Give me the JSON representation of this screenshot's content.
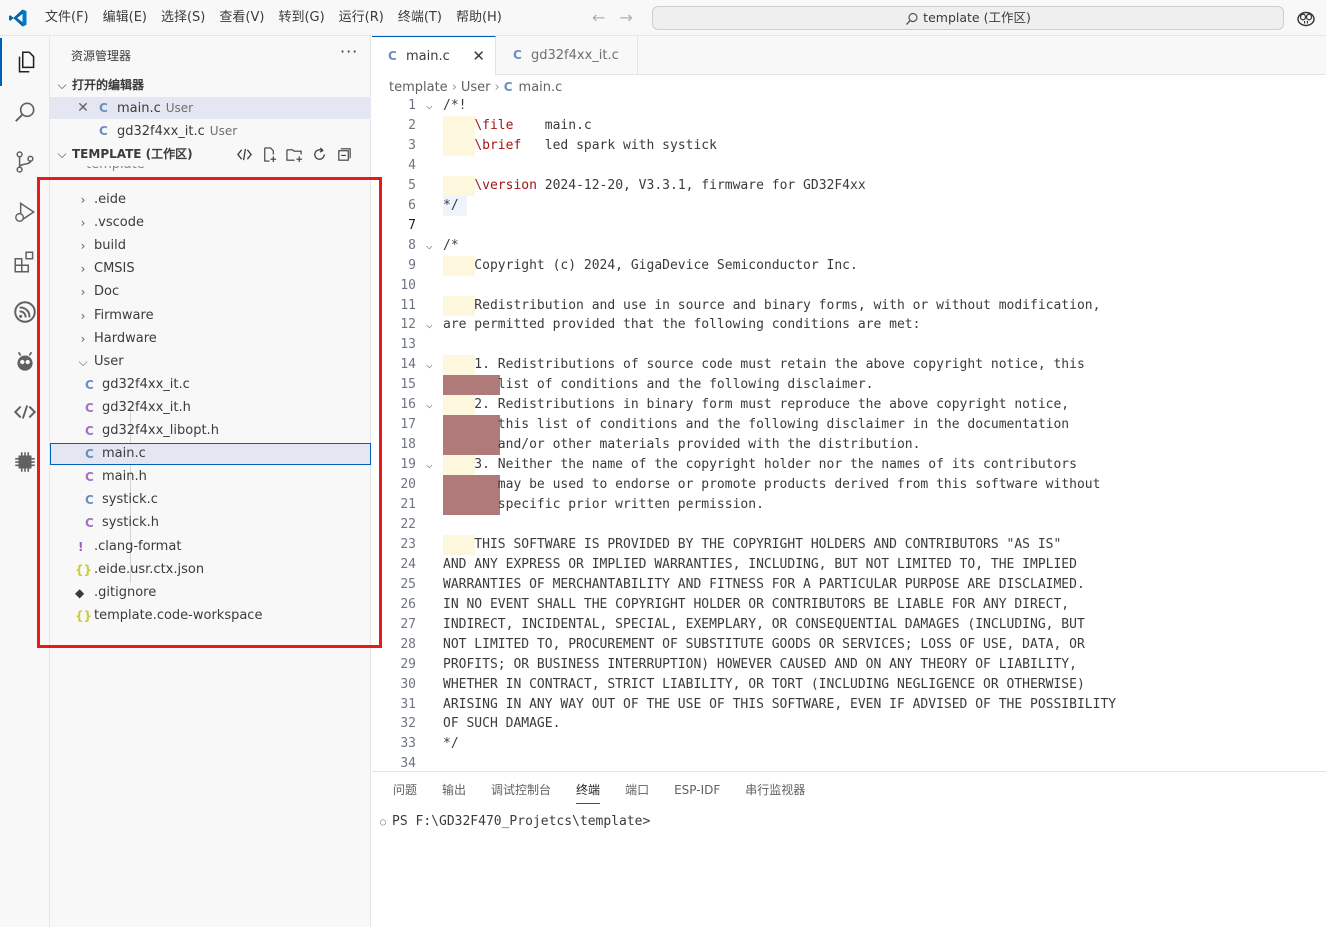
{
  "menu": [
    "文件(F)",
    "编辑(E)",
    "选择(S)",
    "查看(V)",
    "转到(G)",
    "运行(R)",
    "终端(T)",
    "帮助(H)"
  ],
  "command_center": "template (工作区)",
  "sidebar": {
    "title": "资源管理器",
    "more": "···",
    "open_editors": {
      "label": "打开的编辑器",
      "items": [
        {
          "name": "main.c",
          "desc": "User"
        },
        {
          "name": "gd32f4xx_it.c",
          "desc": "User"
        }
      ]
    },
    "workspace": {
      "label": "TEMPLATE (工作区)",
      "root": "template",
      "folders": [
        ".eide",
        ".vscode",
        "build",
        "CMSIS",
        "Doc",
        "Firmware",
        "Hardware",
        "User"
      ],
      "user_files": [
        "gd32f4xx_it.c",
        "gd32f4xx_it.h",
        "gd32f4xx_libopt.h",
        "main.c",
        "main.h",
        "systick.c",
        "systick.h"
      ],
      "root_files": [
        ".clang-format",
        ".eide.usr.ctx.json",
        ".gitignore",
        "template.code-workspace"
      ]
    }
  },
  "tabs": [
    {
      "label": "main.c",
      "active": true
    },
    {
      "label": "gd32f4xx_it.c",
      "active": false
    }
  ],
  "breadcrumb": [
    "template",
    "User",
    "main.c"
  ],
  "code_lines": [
    "/*!",
    "    \\file    main.c",
    "    \\brief   led spark with systick",
    "",
    "    \\version 2024-12-20, V3.3.1, firmware for GD32F4xx",
    "*/",
    "",
    "/*",
    "    Copyright (c) 2024, GigaDevice Semiconductor Inc.",
    "",
    "    Redistribution and use in source and binary forms, with or without modification,",
    "are permitted provided that the following conditions are met:",
    "",
    "    1. Redistributions of source code must retain the above copyright notice, this",
    "       list of conditions and the following disclaimer.",
    "    2. Redistributions in binary form must reproduce the above copyright notice,",
    "       this list of conditions and the following disclaimer in the documentation",
    "       and/or other materials provided with the distribution.",
    "    3. Neither the name of the copyright holder nor the names of its contributors",
    "       may be used to endorse or promote products derived from this software without",
    "       specific prior written permission.",
    "",
    "    THIS SOFTWARE IS PROVIDED BY THE COPYRIGHT HOLDERS AND CONTRIBUTORS \"AS IS\"",
    "AND ANY EXPRESS OR IMPLIED WARRANTIES, INCLUDING, BUT NOT LIMITED TO, THE IMPLIED",
    "WARRANTIES OF MERCHANTABILITY AND FITNESS FOR A PARTICULAR PURPOSE ARE DISCLAIMED.",
    "IN NO EVENT SHALL THE COPYRIGHT HOLDER OR CONTRIBUTORS BE LIABLE FOR ANY DIRECT,",
    "INDIRECT, INCIDENTAL, SPECIAL, EXEMPLARY, OR CONSEQUENTIAL DAMAGES (INCLUDING, BUT",
    "NOT LIMITED TO, PROCUREMENT OF SUBSTITUTE GOODS OR SERVICES; LOSS OF USE, DATA, OR",
    "PROFITS; OR BUSINESS INTERRUPTION) HOWEVER CAUSED AND ON ANY THEORY OF LIABILITY,",
    "WHETHER IN CONTRACT, STRICT LIABILITY, OR TORT (INCLUDING NEGLIGENCE OR OTHERWISE)",
    "ARISING IN ANY WAY OUT OF THE USE OF THIS SOFTWARE, EVEN IF ADVISED OF THE POSSIBILITY",
    "OF SUCH DAMAGE.",
    "*/",
    ""
  ],
  "current_line": 7,
  "panel": {
    "tabs": [
      "问题",
      "输出",
      "调试控制台",
      "终端",
      "端口",
      "ESP-IDF",
      "串行监视器"
    ],
    "active_tab": "终端",
    "terminal_prompt": "PS F:\\GD32F470_Projetcs\\template>"
  },
  "colors": {
    "accent": "#005fb8",
    "highlight_box": "#e8191b",
    "keyword": "#a31515"
  }
}
